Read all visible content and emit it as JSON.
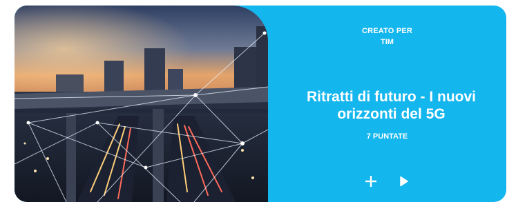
{
  "card": {
    "hero_image": {
      "name": "highway-city-network-image"
    },
    "created_for_label": "CREATO PER",
    "brand_label": "TIM",
    "title": "Ritratti di futuro - I nuovi orizzonti del 5G",
    "episodes_label": "7 PUNTATE",
    "actions": {
      "add_icon": "plus-icon",
      "play_icon": "play-icon"
    },
    "colors": {
      "panel": "#14b6ee",
      "text": "#ffffff"
    }
  }
}
